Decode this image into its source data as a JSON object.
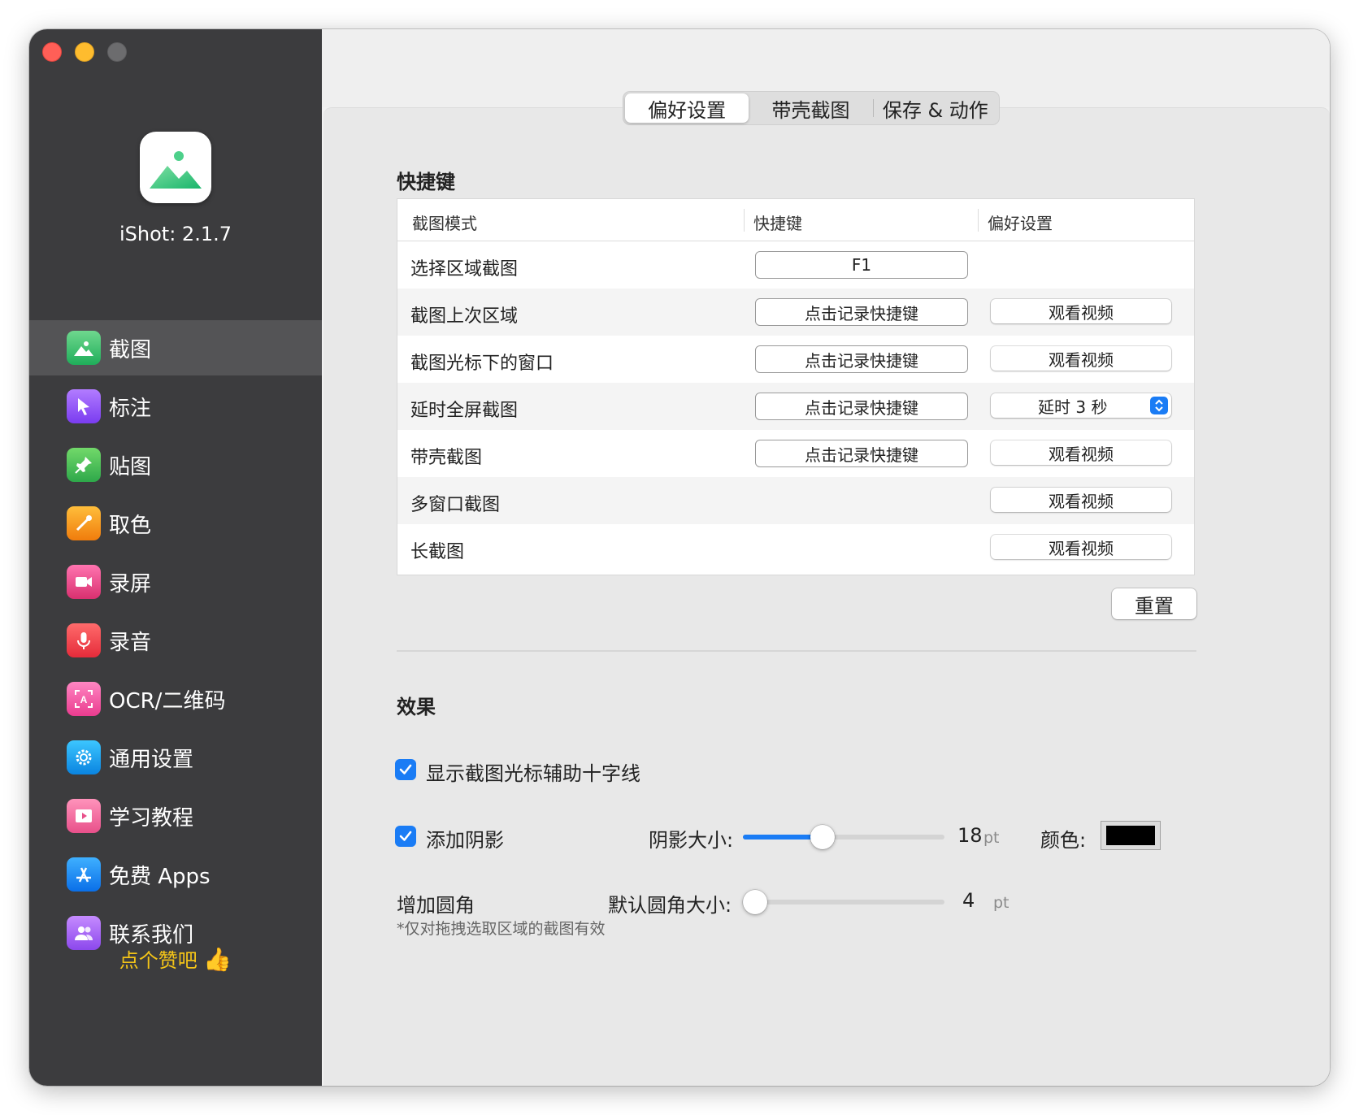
{
  "sidebar": {
    "app_version": "iShot: 2.1.7",
    "items": [
      {
        "label": "截图",
        "icon": "photo-icon",
        "color": "#34c26b"
      },
      {
        "label": "标注",
        "icon": "cursor-icon",
        "color": "#8e5cf0"
      },
      {
        "label": "贴图",
        "icon": "pin-icon",
        "color": "#3dbd4e"
      },
      {
        "label": "取色",
        "icon": "eyedropper-icon",
        "color": "#f59a12"
      },
      {
        "label": "录屏",
        "icon": "video-icon",
        "color": "#e84a8c"
      },
      {
        "label": "录音",
        "icon": "microphone-icon",
        "color": "#f0424a"
      },
      {
        "label": "OCR/二维码",
        "icon": "ocr-icon",
        "color": "#f25aa6"
      },
      {
        "label": "通用设置",
        "icon": "gear-icon",
        "color": "#1ca4f0"
      },
      {
        "label": "学习教程",
        "icon": "tutorial-icon",
        "color": "#f0679a"
      },
      {
        "label": "免费 Apps",
        "icon": "app-store-icon",
        "color": "#1b8ef5"
      },
      {
        "label": "联系我们",
        "icon": "contacts-icon",
        "color": "#a95ef0"
      }
    ],
    "like_text": "点个赞吧",
    "like_icon": "👍"
  },
  "tabs": [
    "偏好设置",
    "带壳截图",
    "保存 & 动作"
  ],
  "shortcuts": {
    "title": "快捷键",
    "headers": [
      "截图模式",
      "快捷键",
      "偏好设置"
    ],
    "rows": [
      {
        "name": "选择区域截图",
        "hotkey": "F1",
        "pref": null
      },
      {
        "name": "截图上次区域",
        "hotkey": "点击记录快捷键",
        "pref": "观看视频"
      },
      {
        "name": "截图光标下的窗口",
        "hotkey": "点击记录快捷键",
        "pref": "观看视频"
      },
      {
        "name": "延时全屏截图",
        "hotkey": "点击记录快捷键",
        "pref_select": "延时 3 秒"
      },
      {
        "name": "带壳截图",
        "hotkey": "点击记录快捷键",
        "pref": "观看视频"
      },
      {
        "name": "多窗口截图",
        "hotkey": null,
        "pref": "观看视频"
      },
      {
        "name": "长截图",
        "hotkey": null,
        "pref": "观看视频"
      }
    ],
    "reset_label": "重置"
  },
  "effects": {
    "title": "效果",
    "crosshair_label": "显示截图光标辅助十字线",
    "crosshair_checked": true,
    "shadow_label": "添加阴影",
    "shadow_checked": true,
    "shadow_size_label": "阴影大小:",
    "shadow_size_value": "18",
    "shadow_size_fraction": 0.38,
    "unit": "pt",
    "color_label": "颜色:",
    "shadow_color": "#000000",
    "corner_label": "增加圆角",
    "corner_note": "*仅对拖拽选取区域的截图有效",
    "corner_size_label": "默认圆角大小:",
    "corner_size_value": "4",
    "corner_size_fraction": 0.0
  },
  "colors": {
    "accent": "#1a7cf5",
    "sidebar_bg": "#3c3c3e",
    "like": "#f5c518"
  }
}
